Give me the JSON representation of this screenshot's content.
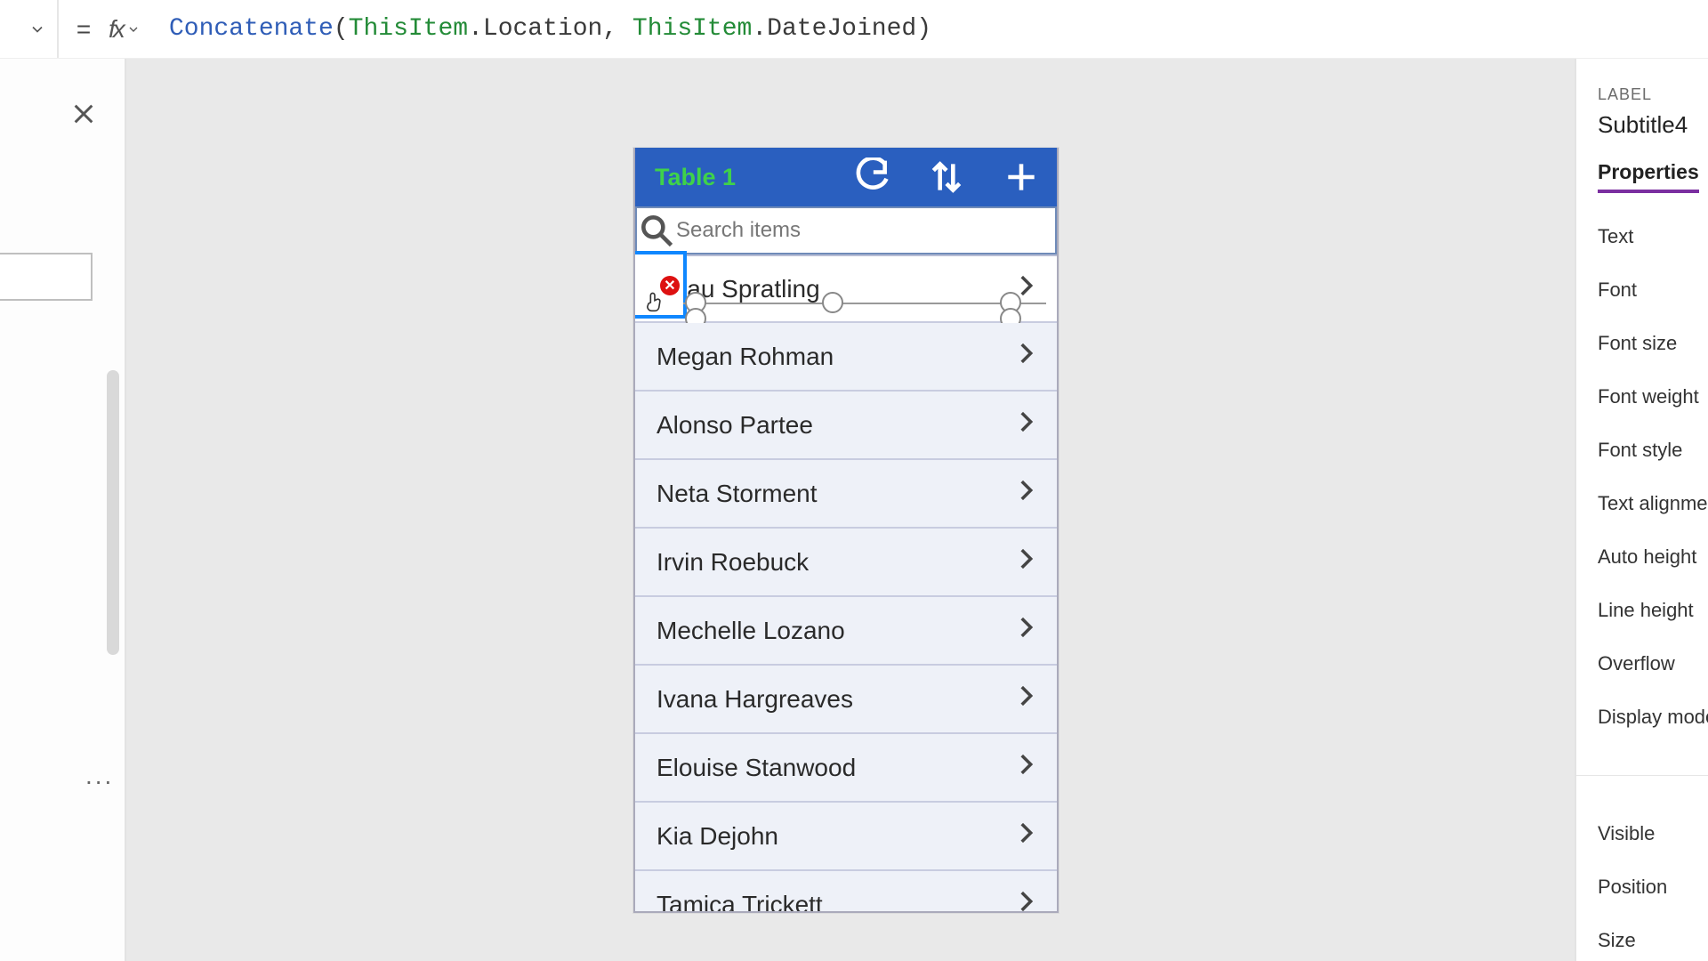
{
  "formula_bar": {
    "equals": "=",
    "fx": "fx",
    "tokens": {
      "fn": "Concatenate",
      "open": "(",
      "thisitem1": "ThisItem",
      "dot1": ".",
      "prop1": "Location",
      "comma": ", ",
      "thisitem2": "ThisItem",
      "dot2": ".",
      "prop2": "DateJoined",
      "close": ")"
    }
  },
  "left_panel": {
    "dots": "..."
  },
  "app": {
    "title": "Table 1",
    "search_placeholder": "Search items",
    "items": [
      "Beau Spratling",
      "Megan Rohman",
      "Alonso Partee",
      "Neta Storment",
      "Irvin Roebuck",
      "Mechelle Lozano",
      "Ivana Hargreaves",
      "Elouise Stanwood",
      "Kia Dejohn",
      "Tamica Trickett"
    ],
    "error_badge": "✕"
  },
  "properties": {
    "type_label": "LABEL",
    "control_name": "Subtitle4",
    "tab": "Properties",
    "items": [
      "Text",
      "Font",
      "Font size",
      "Font weight",
      "Font style",
      "Text alignment",
      "Auto height",
      "Line height",
      "Overflow",
      "Display mode"
    ],
    "items2": [
      "Visible",
      "Position",
      "Size"
    ]
  }
}
